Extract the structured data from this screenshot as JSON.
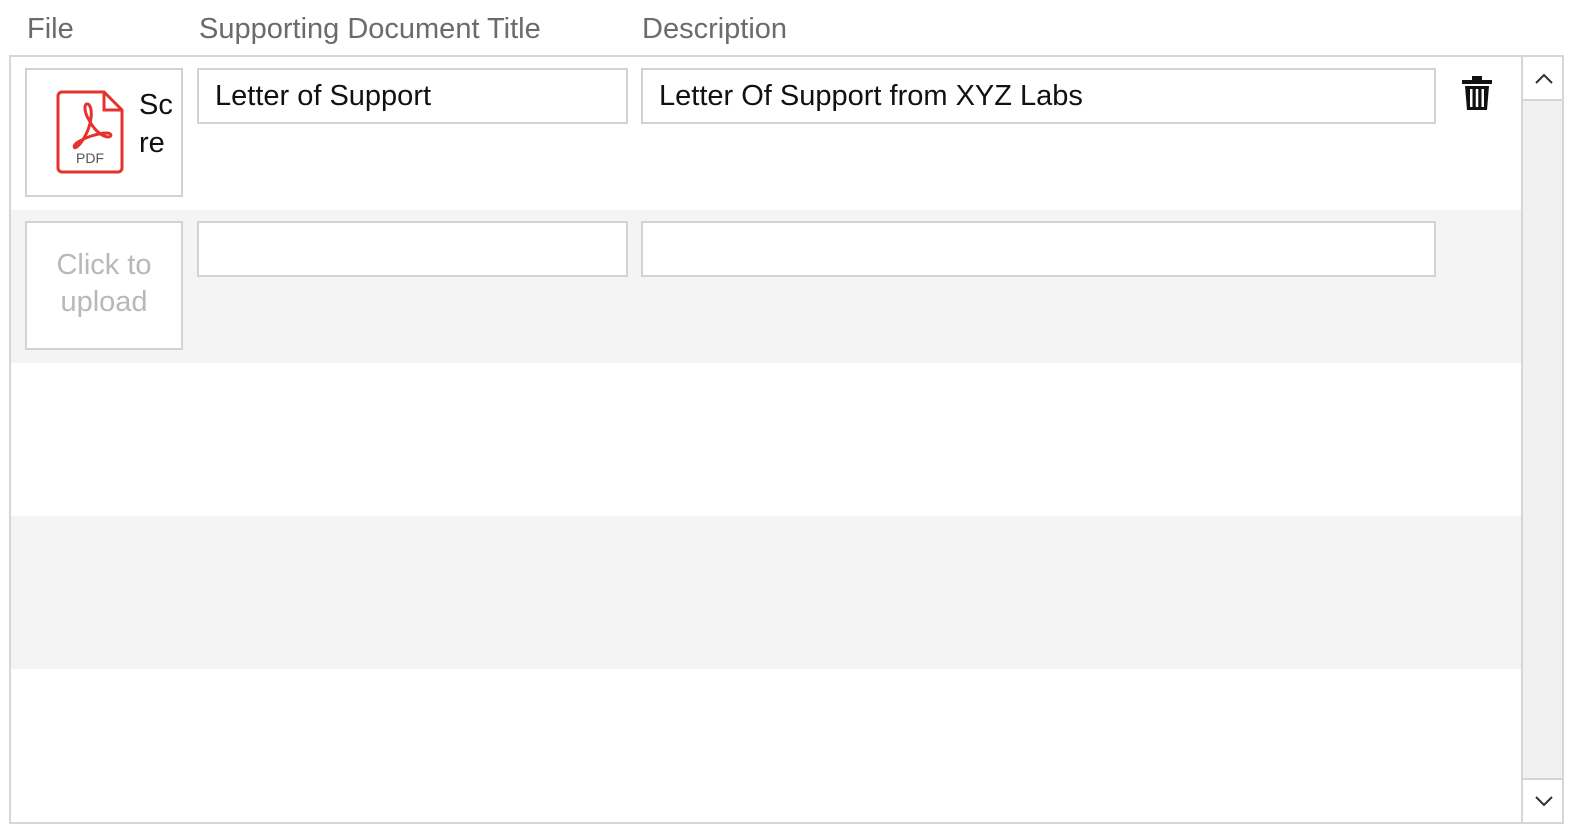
{
  "headers": {
    "file": "File",
    "title": "Supporting Document Title",
    "description": "Description"
  },
  "rows": [
    {
      "file_type": "PDF",
      "file_name": "Scre",
      "title_value": "Letter of Support",
      "description_value": "Letter Of Support from XYZ Labs"
    },
    {
      "upload_label": "Click to upload",
      "title_value": "",
      "description_value": ""
    }
  ],
  "icons": {
    "file": "pdf-file-icon",
    "delete": "trash-icon",
    "scroll_up": "chevron-up-icon",
    "scroll_down": "chevron-down-icon"
  },
  "colors": {
    "pdf_red": "#e5322d",
    "header_text": "#6b6b6b",
    "placeholder_text": "#b8b8b8",
    "alt_row": "#f4f4f4",
    "border": "#d3d3d3"
  }
}
